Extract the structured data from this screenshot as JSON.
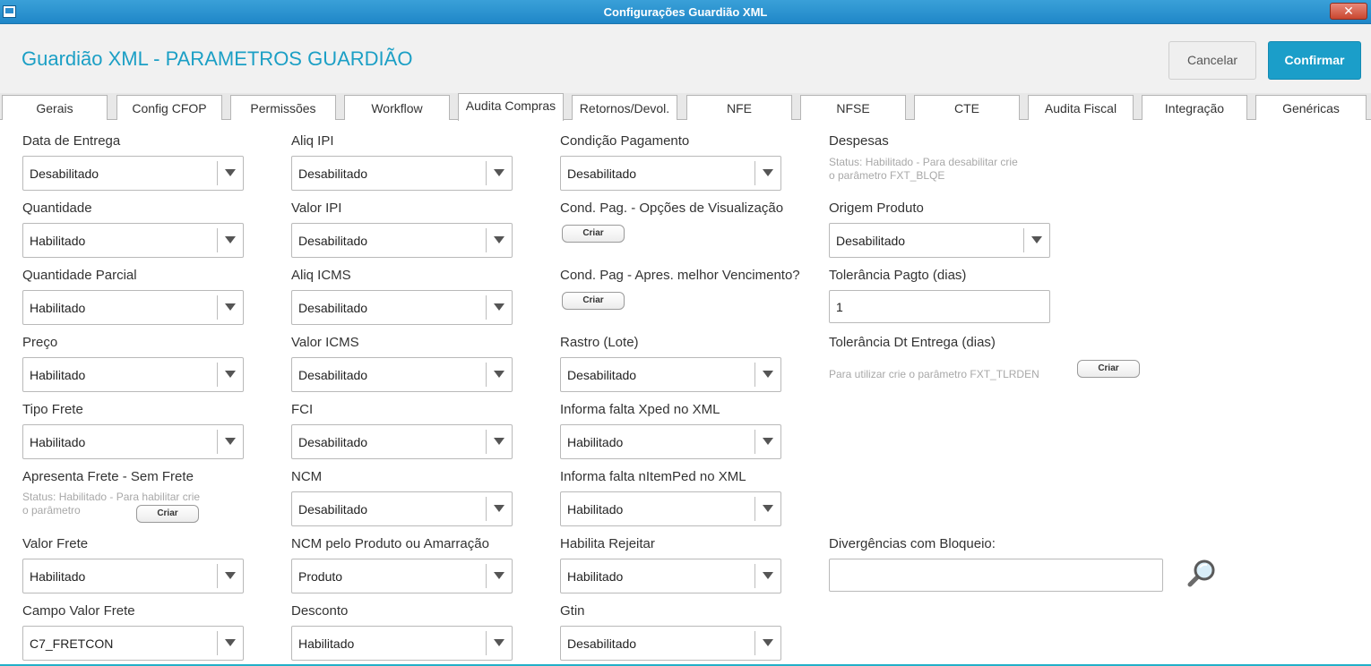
{
  "window": {
    "title": "Configurações Guardião XML",
    "close_label": "✕"
  },
  "header": {
    "title": "Guardião XML - PARAMETROS GUARDIÃO",
    "cancel_label": "Cancelar",
    "confirm_label": "Confirmar"
  },
  "tabs": [
    "Gerais",
    "Config CFOP",
    "Permissões",
    "Workflow",
    "Audita Compras",
    "Retornos/Devol.",
    "NFE",
    "NFSE",
    "CTE",
    "Audita Fiscal",
    "Integração",
    "Genéricas"
  ],
  "active_tab": "Audita Compras",
  "col1": {
    "data_entrega": {
      "label": "Data de Entrega",
      "value": "Desabilitado"
    },
    "quantidade": {
      "label": "Quantidade",
      "value": "Habilitado"
    },
    "quantidade_parcial": {
      "label": "Quantidade Parcial",
      "value": "Habilitado"
    },
    "preco": {
      "label": "Preço",
      "value": "Habilitado"
    },
    "tipo_frete": {
      "label": "Tipo Frete",
      "value": "Habilitado"
    },
    "apresenta_frete": {
      "label": "Apresenta Frete - Sem Frete",
      "hint1": "Status: Habilitado - Para habilitar crie",
      "hint2": "o parâmetro",
      "button": "Criar"
    },
    "valor_frete": {
      "label": "Valor Frete",
      "value": "Habilitado"
    },
    "campo_valor_frete": {
      "label": "Campo Valor Frete",
      "value": "C7_FRETCON"
    }
  },
  "col2": {
    "aliq_ipi": {
      "label": "Aliq IPI",
      "value": "Desabilitado"
    },
    "valor_ipi": {
      "label": "Valor IPI",
      "value": "Desabilitado"
    },
    "aliq_icms": {
      "label": "Aliq ICMS",
      "value": "Desabilitado"
    },
    "valor_icms": {
      "label": "Valor ICMS",
      "value": "Desabilitado"
    },
    "fci": {
      "label": "FCI",
      "value": "Desabilitado"
    },
    "ncm": {
      "label": "NCM",
      "value": "Desabilitado"
    },
    "ncm_produto": {
      "label": "NCM pelo Produto ou Amarração",
      "value": "Produto"
    },
    "desconto": {
      "label": "Desconto",
      "value": "Habilitado"
    }
  },
  "col3": {
    "condicao_pagamento": {
      "label": "Condição Pagamento",
      "value": "Desabilitado"
    },
    "cond_pag_opcoes": {
      "label": "Cond. Pag. - Opções de Visualização",
      "button": "Criar"
    },
    "cond_pag_apres": {
      "label": "Cond. Pag - Apres. melhor Vencimento?",
      "button": "Criar"
    },
    "rastro": {
      "label": "Rastro (Lote)",
      "value": "Desabilitado"
    },
    "falta_xped": {
      "label": "Informa falta Xped no XML",
      "value": "Habilitado"
    },
    "falta_nitemped": {
      "label": "Informa falta nItemPed no XML",
      "value": "Habilitado"
    },
    "habilita_rejeitar": {
      "label": "Habilita Rejeitar",
      "value": "Habilitado"
    },
    "gtin": {
      "label": "Gtin",
      "value": "Desabilitado"
    }
  },
  "col4": {
    "despesas": {
      "label": "Despesas",
      "hint1": "Status: Habilitado - Para desabilitar crie",
      "hint2": "o parâmetro FXT_BLQE"
    },
    "origem_produto": {
      "label": "Origem Produto",
      "value": "Desabilitado"
    },
    "tolerancia_pagto": {
      "label": "Tolerância Pagto (dias)",
      "value": "1"
    },
    "tolerancia_entrega": {
      "label": "Tolerância Dt Entrega (dias)",
      "hint": "Para utilizar crie o parâmetro FXT_TLRDEN",
      "button": "Criar"
    },
    "divergencias": {
      "label": "Divergências com Bloqueio:",
      "value": ""
    }
  }
}
